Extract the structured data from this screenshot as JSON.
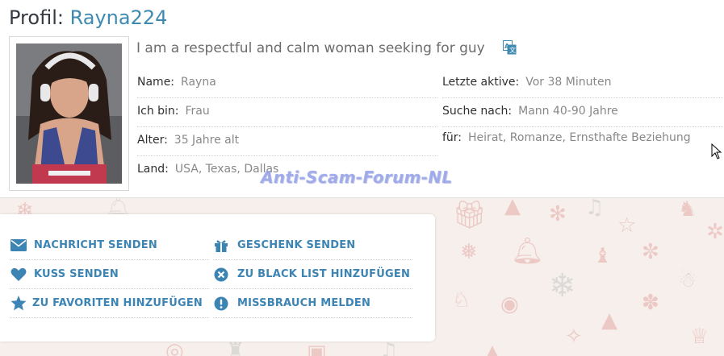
{
  "profile": {
    "title_prefix": "Profil:",
    "username": "Rayna224",
    "headline": "I am a respectful and calm woman seeking for guy"
  },
  "details_left": [
    {
      "label": "Name:",
      "value": "Rayna"
    },
    {
      "label": "Ich bin:",
      "value": "Frau"
    },
    {
      "label": "Alter:",
      "value": "35 Jahre alt"
    },
    {
      "label": "Land:",
      "value": "USA, Texas, Dallas"
    }
  ],
  "details_right": [
    {
      "label": "Letzte aktive:",
      "value": "Vor 38 Minuten"
    },
    {
      "label": "Suche nach:",
      "value": "Mann 40-90 Jahre"
    },
    {
      "label": "für:",
      "value": "Heirat, Romanze, Ernsthafte Beziehung"
    }
  ],
  "watermark": "Anti-Scam-Forum-NL",
  "actions": [
    {
      "label": "NACHRICHT SENDEN",
      "icon": "envelope-icon"
    },
    {
      "label": "GESCHENK SENDEN",
      "icon": "gift-icon"
    },
    {
      "label": "KUSS SENDEN",
      "icon": "heart-icon"
    },
    {
      "label": "ZU BLACK LIST HINZUFÜGEN",
      "icon": "x-circle-icon"
    },
    {
      "label": "ZU FAVORITEN HINZUFÜGEN",
      "icon": "star-icon"
    },
    {
      "label": "MISSBRAUCH MELDEN",
      "icon": "exclamation-circle-icon"
    }
  ],
  "colors": {
    "accent": "#3c84b4",
    "username": "#3f8ab0",
    "label": "#2f2f2f",
    "value": "#888888"
  }
}
